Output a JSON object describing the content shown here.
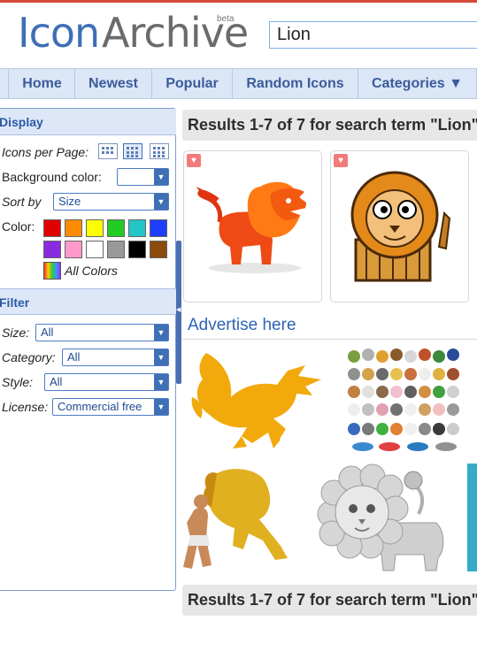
{
  "logo": {
    "icon": "Icon",
    "archive": "Archive",
    "beta": "beta"
  },
  "search": {
    "value": "Lion"
  },
  "nav": {
    "items": [
      "Home",
      "Newest",
      "Popular",
      "Random Icons",
      "Categories ▼"
    ]
  },
  "sidebar": {
    "display_title": "Display",
    "icons_per_page_label": "Icons per Page:",
    "background_color_label": "Background color:",
    "sort_by_label": "Sort by",
    "sort_by_value": "Size",
    "color_label": "Color:",
    "all_colors_label": "All Colors",
    "swatches": [
      "#e00000",
      "#ff8c00",
      "#ffff00",
      "#22cc22",
      "#22c6c6",
      "#1f3dff",
      "#8a2be2",
      "#ff99cc",
      "#ffffff",
      "#999999",
      "#000000",
      "#8b4b0b"
    ],
    "filter_title": "Filter",
    "size_label": "Size:",
    "size_value": "All",
    "category_label": "Category:",
    "category_value": "All",
    "style_label": "Style:",
    "style_value": "All",
    "license_label": "License:",
    "license_value": "Commercial free"
  },
  "results": {
    "header_text": "Results 1-7 of 7 for search term \"Lion\"",
    "footer_text": "Results 1-7 of 7 for search term \"Lion\""
  },
  "icons": [
    {
      "name": "red-lion-icon"
    },
    {
      "name": "cartoon-lion-icon"
    }
  ],
  "ads": {
    "title": "Advertise here"
  },
  "colors": {
    "accent": "#3f6fb5",
    "nav_bg": "#dbe6f7",
    "top_border": "#d64a38"
  }
}
